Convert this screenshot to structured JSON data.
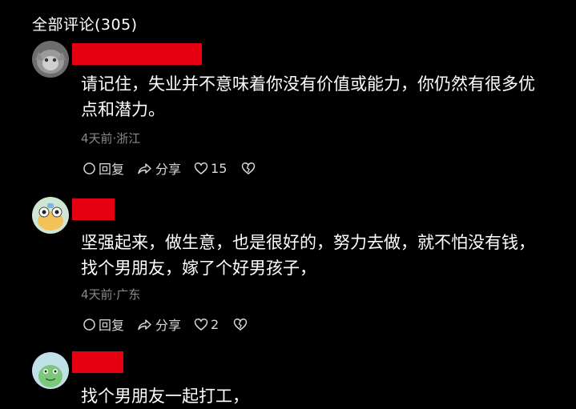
{
  "header": {
    "title": "全部评论(305)"
  },
  "colors": {
    "background": "#000000",
    "redaction": "#e60012",
    "meta": "#8a8a8a"
  },
  "actions": {
    "reply_label": "回复",
    "share_label": "分享"
  },
  "comments": [
    {
      "avatar": "cat-avatar",
      "lines": [
        "请记住，失业并不意味着你没有价值或能力，你仍然有很多优",
        "点和潜力。"
      ],
      "meta": "4天前·浙江",
      "likes": "15"
    },
    {
      "avatar": "cartoon-frog-avatar",
      "lines": [
        "坚强起来，做生意，也是很好的，努力去做，就不怕没有钱，",
        "找个男朋友，嫁了个好男孩子，"
      ],
      "meta": "4天前·广东",
      "likes": "2"
    },
    {
      "avatar": "cartoon-dino-avatar",
      "lines": [
        "找个男朋友一起打工，"
      ]
    }
  ]
}
